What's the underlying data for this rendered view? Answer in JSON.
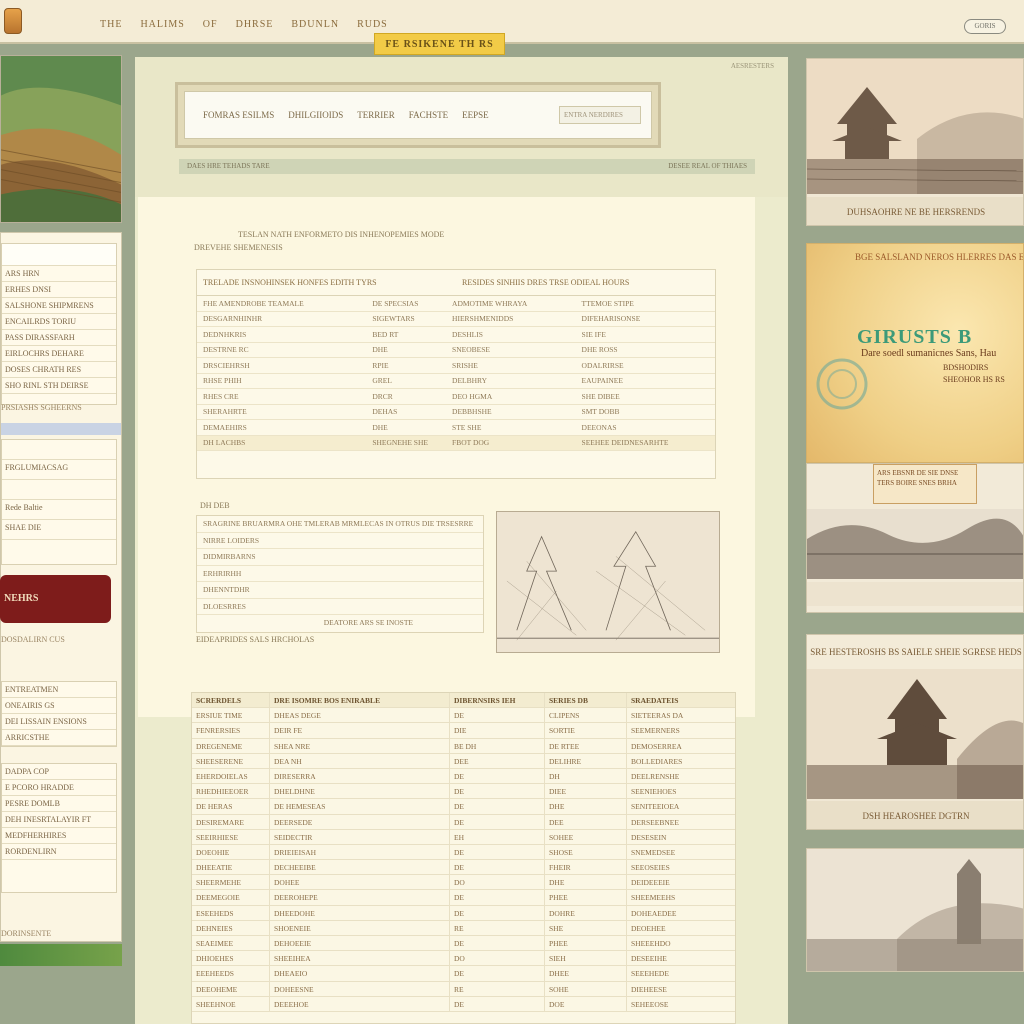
{
  "topbar": {
    "nav": [
      "THE",
      "HALIMS",
      "OF",
      "DHRSE",
      "BDUNLN",
      "RUDS"
    ],
    "right_button": "GORIS"
  },
  "banner_tab": "FE RSIKENE TH RS",
  "left": {
    "list_rows": [
      "ARS HRN",
      "ERHES DNSI",
      "SALSHONE SHIPMRENS",
      "ENCAILRDS TORIU",
      "PASS DIRASSFARH",
      "EIRLOCHRS DEHARE",
      "DOSES CHRATH RES",
      "SHO RINL STH DEIRSE"
    ],
    "caption_1": "PRSIASHS SGHEERNS",
    "box_rows": [
      "FRGLUMIACSAG",
      "Rede Baltie",
      "SHAE DIE"
    ],
    "button": "NEHRS",
    "caption_2": "DOSDALIRN CUS",
    "lower_rows": [
      "ENTREATMEN",
      "ONEAIRIS GS",
      "DEI LISSAIN ENSIONS",
      "ARRICSTHE"
    ],
    "lower_rows_2": [
      "DADPA COP",
      "E PCORO HRADDE",
      "PESRE DOMLB",
      "DEH INESRTALAYIR FT",
      "MEDFHERHIRES",
      "RORDENLIRN"
    ],
    "footer": "DORINSENTE"
  },
  "header": {
    "corner": "AESRESTERS",
    "search_labels": [
      "FOMRAS ESILMS",
      "DHILGIIOIDS",
      "TERRIER",
      "FACHSTE",
      "EEPSE"
    ],
    "search_placeholder": "ENTRA NERDIRES",
    "strip_left": "DAES HRE TEHADS TARE",
    "strip_right": "DESEE REAL OF THIAES"
  },
  "document": {
    "intro": "TESLAN NATH ENFORMETO DIS INHENOPEMIES MODE",
    "subhead": "DREVEHE SHEMENESIS",
    "sheet_headers": [
      "TRELADE INSNOHINSEK HONFES EDITH TYRS",
      "RESIDES SINHIIS DRES TRSE ODIEAL HOURS"
    ],
    "sheet_subheaders": [
      "FHE AMENDROBE TEAMALE",
      "DE SPECSIAS",
      "ADMOTIME WHRAYA",
      "TTEMOE STIPE"
    ],
    "sheet_rows": [
      [
        "DESGARNHINHR",
        "SIGEWTARS",
        "HIERSHMENIDDS",
        "DIFEHARISONSE"
      ],
      [
        "DEDNHKRIS",
        "BED RT",
        "DESHLIS",
        "SIE IFE"
      ],
      [
        "DESTRNE RC",
        "DHE",
        "SNEOBESE",
        "DHE ROSS"
      ],
      [
        "DRSCIEHRSH",
        "RPIE",
        "SRISHE",
        "ODALRIRSE"
      ],
      [
        "RHSE PHIH",
        "GREL",
        "DELBHRY",
        "EAUPAINEE"
      ],
      [
        "RHES CRE",
        "DRCR",
        "DEO HGMA",
        "SHE DIBEE"
      ],
      [
        "SHERAHRTE",
        "DEHAS",
        "DEBBHSHE",
        "SMT DOBB"
      ],
      [
        "DEMAEHIRS",
        "DHE",
        "STE SHE",
        "DEEONAS"
      ]
    ],
    "sheet_footer": [
      "DH LACHBS",
      "SHEGNEHE SHE",
      "FBOT DOG",
      "SEEHEE DEIDNESARHTE"
    ],
    "notes_title": "DH DEB",
    "notes_rows": [
      "SRAGRINE BRUARMRA OHE TMLERAB MRMLECAS IN OTRUS DIE TRSESRRE",
      "NIRRE LOIDERS",
      "DIDMIRBARNS",
      "ERHRIRHH",
      "DHENNTDHR",
      "DLOESRRES"
    ],
    "notes_footer": "DEATORE ARS SE INOSTE",
    "notes_caption": "EIDEAPRIDES SALS HRCHOLAS"
  },
  "table": {
    "headers": [
      "SCRERDELS",
      "DRE ISOMRE BOS ENIRABLE",
      "DIBERNSIRS IEH",
      "SERIES DB",
      "SRAEDATEIS"
    ],
    "rows": [
      [
        "ERSIUE TIME",
        "DHEAS DEGE",
        "DE",
        "CLIPENS",
        "SIETEERAS DA"
      ],
      [
        "FENRERSIES",
        "DEIR FE",
        "DIE",
        "SORTIE",
        "SEEMERNERS"
      ],
      [
        "DREGENEME",
        "SHEA NRE",
        "BE DH",
        "DE RTEE",
        "DEMOSERREA"
      ],
      [
        "SHEESERENE",
        "DEA NH",
        "DEE",
        "DELIHRE",
        "BOLLEDIARES"
      ],
      [
        "EHERDOIELAS",
        "DIRESERRA",
        "DE",
        "DH",
        "DEELRENSHE"
      ],
      [
        "RHEDHIEEOER",
        "DHELDHNE",
        "DE",
        "DIEE",
        "SEENIEHOES"
      ],
      [
        "DE HERAS",
        "DE HEMESEAS",
        "DE",
        "DHE",
        "SENITEEIOEA"
      ],
      [
        "DESIREMARE",
        "DEERSEDE",
        "DE",
        "DEE",
        "DERSEEBNEE"
      ],
      [
        "SEEIRHIESE",
        "SEIDECTIR",
        "EH",
        "SOHEE",
        "DESESEIN"
      ],
      [
        "DOEOHIE",
        "DRIEIEISAH",
        "DE",
        "SHOSE",
        "SNEMEDSEE"
      ],
      [
        "DHEEATIE",
        "DECHEEIBE",
        "DE",
        "FHEIR",
        "SEEOSEIES"
      ],
      [
        "SHEERMEHE",
        "DOHEE",
        "DO",
        "DHE",
        "DEIDEEEIE"
      ],
      [
        "DEEMEGOIE",
        "DEEROHEPE",
        "DE",
        "PHEE",
        "SHEEMEEHS"
      ],
      [
        "ESEEHEDS",
        "DHEEDOHE",
        "DE",
        "DOHRE",
        "DOHEAEDEE"
      ],
      [
        "DEHNEIES",
        "SHOENEIE",
        "RE",
        "SHE",
        "DEOEHEE"
      ],
      [
        "SEAEIMEE",
        "DEHOEEIE",
        "DE",
        "PHEE",
        "SHEEEHDO"
      ],
      [
        "DHIOEHES",
        "SHEEIHEA",
        "DO",
        "SIEH",
        "DESEEIHE"
      ],
      [
        "EEEHEEDS",
        "DHEAEIO",
        "DE",
        "DHEE",
        "SEEEHEDE"
      ],
      [
        "DEEOHEME",
        "DOHEESNE",
        "RE",
        "SOHE",
        "DIEHEESE"
      ],
      [
        "SHEEHNOE",
        "DEEEHOE",
        "DE",
        "DOE",
        "SEHEEOSE"
      ]
    ]
  },
  "right": {
    "card1_caption": "DUHSAOHRE NE BE HERSRENDS",
    "poster_top": "BGE SALSLAND NEROS HLERRES DAS ERE",
    "poster_title": "GIRUSTS B",
    "poster_sub": "Dare soedl sumanicnes Sans, Hau",
    "poster_small_1": "BDSHODIRS",
    "poster_small_2": "SHEOHOR HS RS",
    "poster_note": "ARS EBSNR DE SIE DNSE TERS BOIRE SNES BRHA",
    "card3_caption": "SRE HESTEROSHS BS SAIELE SHEIE SGRESE HEDS",
    "card3_footer": "DSH HEAROSHEE DGTRN"
  },
  "colors": {
    "background": "#9ba68c",
    "accent_yellow": "#f2cb47",
    "button_red": "#7e1c1b",
    "paper": "#fcf7e0",
    "poster_title": "#3c9a79"
  }
}
